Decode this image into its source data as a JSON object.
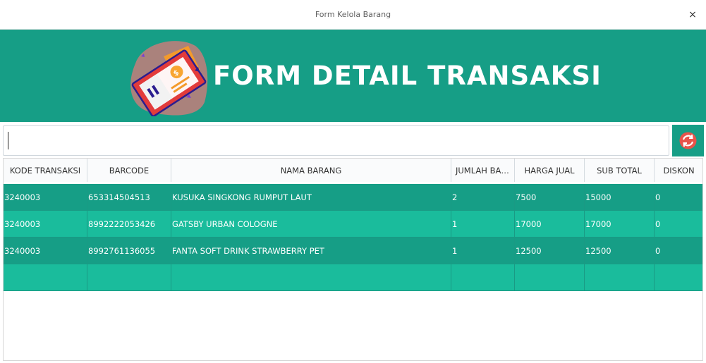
{
  "window": {
    "title": "Form Kelola Barang",
    "close_label": "×"
  },
  "banner": {
    "title": "FORM DETAIL TRANSAKSI",
    "logo_icon": "coupon-ticket-logo-icon"
  },
  "search": {
    "value": "",
    "placeholder": ""
  },
  "refresh_button": {
    "icon": "refresh-icon",
    "color": "#e8534a"
  },
  "table": {
    "columns": [
      "KODE TRANSAKSI",
      "BARCODE",
      "NAMA BARANG",
      "JUMLAH BAR...",
      "HARGA JUAL",
      "SUB TOTAL",
      "DISKON"
    ],
    "rows": [
      [
        "3240003",
        "653314504513",
        "KUSUKA SINGKONG RUMPUT LAUT",
        "2",
        "7500",
        "15000",
        "0"
      ],
      [
        "3240003",
        "8992222053426",
        "GATSBY URBAN COLOGNE",
        "1",
        "17000",
        "17000",
        "0"
      ],
      [
        "3240003",
        "8992761136055",
        "FANTA SOFT DRINK STRAWBERRY PET",
        "1",
        "12500",
        "12500",
        "0"
      ],
      [
        "",
        "",
        "",
        "",
        "",
        "",
        ""
      ]
    ]
  },
  "colors": {
    "primary": "#169e86",
    "row_alt": "#1abc9c",
    "accent": "#e8534a"
  }
}
